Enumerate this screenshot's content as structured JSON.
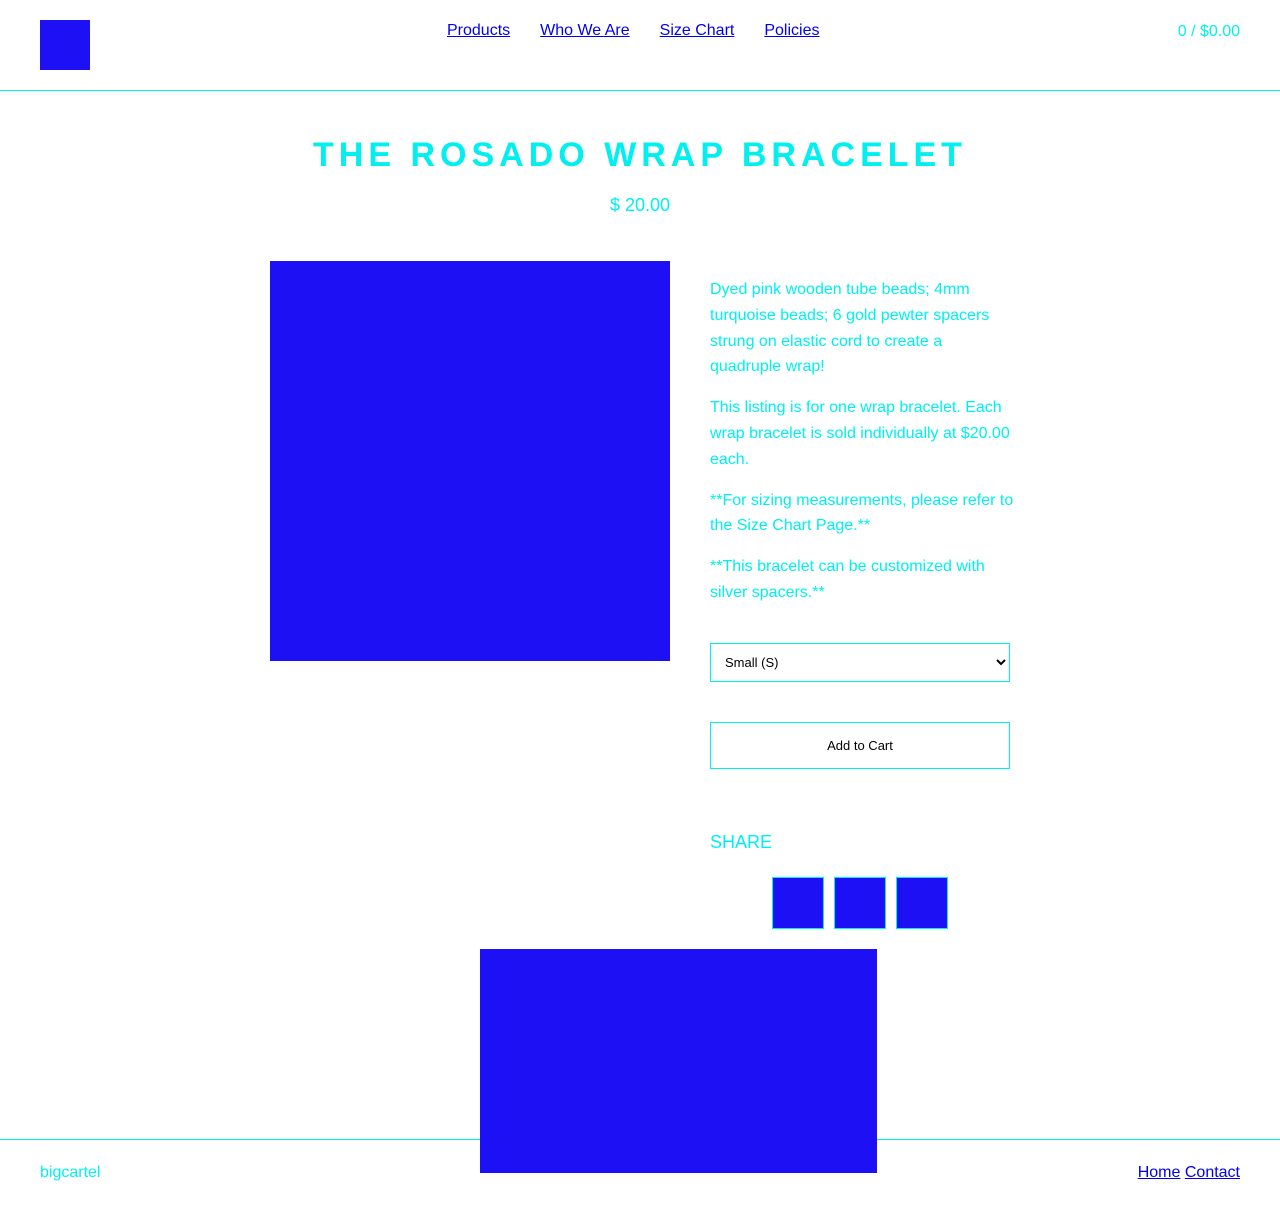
{
  "colors": {
    "accent": "#00f0f0",
    "block": "#1e10f5",
    "link": "#0000ee",
    "background": "#ffffff"
  },
  "header": {
    "nav": [
      {
        "label": "Products"
      },
      {
        "label": "Who We Are"
      },
      {
        "label": "Size Chart"
      },
      {
        "label": "Policies"
      }
    ],
    "cart": "0 / $0.00"
  },
  "product": {
    "title": "THE ROSADO WRAP BRACELET",
    "price": "$ 20.00",
    "description": [
      "Dyed pink wooden tube beads; 4mm turquoise beads; 6 gold pewter spacers strung on elastic cord to create a quadruple wrap!",
      "This listing is for one wrap bracelet. Each wrap bracelet is sold individually at $20.00 each.",
      "**For sizing measurements, please refer to the Size Chart Page.**",
      "**This bracelet can be customized with silver spacers.**"
    ],
    "option_selected": "Small (S)",
    "add_to_cart_label": "Add to Cart"
  },
  "share": {
    "label": "SHARE",
    "icons": [
      "share-icon",
      "share-icon",
      "share-icon"
    ]
  },
  "footer": {
    "brand": "bigcartel",
    "links": [
      {
        "label": "Home"
      },
      {
        "label": "Contact"
      }
    ]
  }
}
